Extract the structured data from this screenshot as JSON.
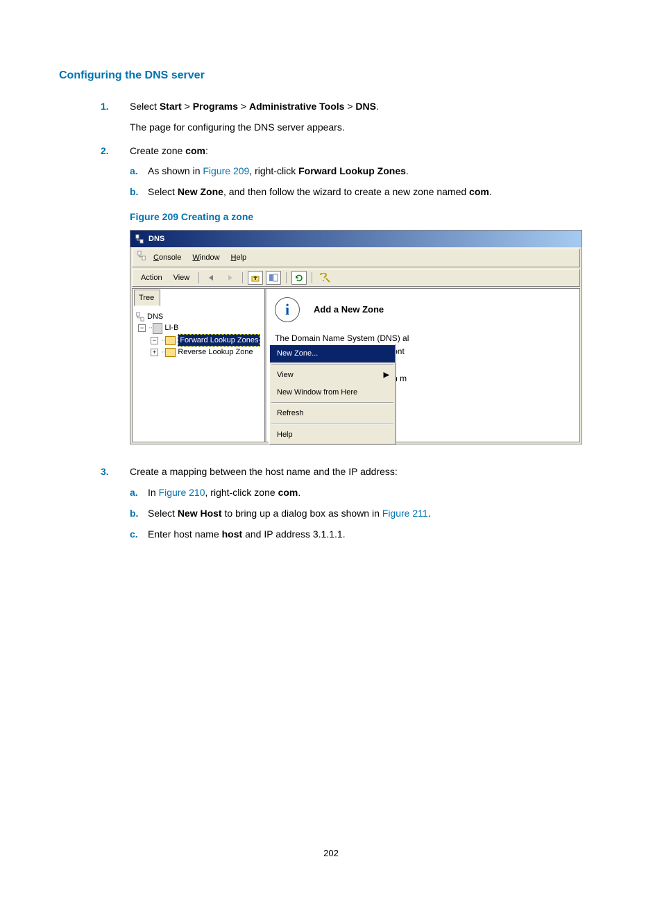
{
  "section_title": "Configuring the DNS server",
  "steps": {
    "s1": {
      "marker": "1.",
      "pre": "Select ",
      "w1": "Start",
      "sep1": " > ",
      "w2": "Programs",
      "sep2": " > ",
      "w3": "Administrative Tools",
      "sep3": " > ",
      "w4": "DNS",
      "post": ".",
      "sub": "The page for configuring the DNS server appears."
    },
    "s2": {
      "marker": "2.",
      "pre": "Create zone ",
      "bold": "com",
      "post": ":",
      "a": {
        "m": "a.",
        "pre": "As shown in ",
        "link": "Figure 209",
        "mid": ", right-click ",
        "bold": "Forward Lookup Zones",
        "post": "."
      },
      "b": {
        "m": "b.",
        "pre": "Select ",
        "bold1": "New Zone",
        "mid": ", and then follow the wizard to create a new zone named ",
        "bold2": "com",
        "post": "."
      }
    },
    "s3": {
      "marker": "3.",
      "text": "Create a mapping between the host name and the IP address:",
      "a": {
        "m": "a.",
        "pre": "In ",
        "link": "Figure 210",
        "mid": ", right-click zone ",
        "bold": "com",
        "post": "."
      },
      "b": {
        "m": "b.",
        "pre": "Select ",
        "bold": "New Host",
        "mid": " to bring up a dialog box as shown in ",
        "link": "Figure 211",
        "post": "."
      },
      "c": {
        "m": "c.",
        "pre": "Enter host name ",
        "bold": "host",
        "post": " and IP address 3.1.1.1."
      }
    }
  },
  "figure_caption": "Figure 209 Creating a zone",
  "dns_window": {
    "title": "DNS",
    "menus": {
      "console": "Console",
      "window": "Window",
      "help": "Help"
    },
    "toolbar": {
      "action": "Action",
      "view": "View"
    },
    "tree_tab": "Tree",
    "tree": {
      "root": "DNS",
      "server": "LI-B",
      "flz": "Forward Lookup Zones",
      "rlz": "Reverse Lookup Zone"
    },
    "context": {
      "new_zone": "New Zone...",
      "view": "View",
      "new_window": "New Window from Here",
      "refresh": "Refresh",
      "help": "Help"
    },
    "right": {
      "title": "Add a New Zone",
      "line1": "The Domain Name System (DNS) al",
      "line2": "information about one or more cont",
      "line3": "To add a new zone, on the Action m"
    }
  },
  "page_number": "202"
}
